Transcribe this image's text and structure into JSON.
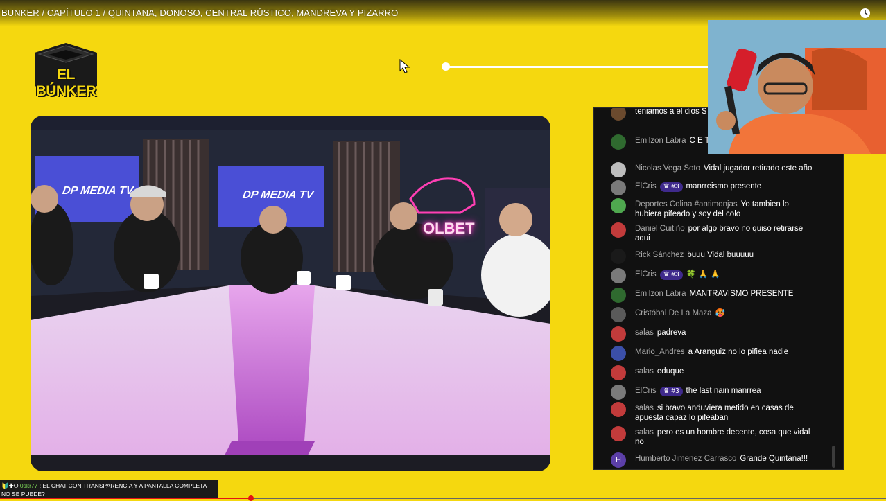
{
  "video": {
    "title": "BUNKER / CAPÍTULO 1 / QUINTANA, DONOSO, CENTRAL RÚSTICO, MANDREVA Y PIZARRO",
    "progress_fraction": 0.283
  },
  "logo": {
    "text": "EL BÚNKER"
  },
  "studio": {
    "tv_label_left": "DP MEDIA TV",
    "tv_label_center": "DP MEDIA TV",
    "neon_sign": "OLBET"
  },
  "chat": {
    "messages": [
      {
        "author": "",
        "badge": "",
        "text": "teniamos a el dios S",
        "avatar_color": "#6b4a2e",
        "avatar_letter": ""
      },
      {
        "author": "Emilzon Labra",
        "badge": "",
        "text": "C E T EL BUNKE",
        "avatar_color": "#2f6a2f",
        "avatar_letter": ""
      },
      {
        "author": "Nicolas Vega Soto",
        "badge": "",
        "text": "Vidal jugador retirado este año",
        "avatar_color": "#bdbdbd",
        "avatar_letter": ""
      },
      {
        "author": "ElCris",
        "badge": "#3",
        "text": "manrreismo presente",
        "avatar_color": "#7a7a7a",
        "avatar_letter": ""
      },
      {
        "author": "Deportes Colina #antimonjas",
        "badge": "",
        "text": "Yo tambien lo hubiera pifeado y soy del colo",
        "avatar_color": "#4fa84f",
        "avatar_letter": ""
      },
      {
        "author": "Daniel Cuitiño",
        "badge": "",
        "text": "por algo bravo no quiso retirarse aqui",
        "avatar_color": "#c23b3b",
        "avatar_letter": ""
      },
      {
        "author": "Rick Sánchez",
        "badge": "",
        "text": "buuu Vidal buuuuu",
        "avatar_color": "#1a1a1a",
        "avatar_letter": ""
      },
      {
        "author": "ElCris",
        "badge": "#3",
        "text": "🍀 🙏 🙏",
        "avatar_color": "#7a7a7a",
        "avatar_letter": ""
      },
      {
        "author": "Emilzon Labra",
        "badge": "",
        "text": "MANTRAVISMO PRESENTE",
        "avatar_color": "#2f6a2f",
        "avatar_letter": ""
      },
      {
        "author": "Cristóbal De La Maza",
        "badge": "",
        "text": "🥵",
        "avatar_color": "#5a5a5a",
        "avatar_letter": ""
      },
      {
        "author": "salas",
        "badge": "",
        "text": "padreva",
        "avatar_color": "#c23b3b",
        "avatar_letter": ""
      },
      {
        "author": "Mario_Andres",
        "badge": "",
        "text": "a Aranguiz no lo pifiea nadie",
        "avatar_color": "#3b4fa8",
        "avatar_letter": ""
      },
      {
        "author": "salas",
        "badge": "",
        "text": "eduque",
        "avatar_color": "#c23b3b",
        "avatar_letter": ""
      },
      {
        "author": "ElCris",
        "badge": "#3",
        "text": "the last nain manrrea",
        "avatar_color": "#7a7a7a",
        "avatar_letter": ""
      },
      {
        "author": "salas",
        "badge": "",
        "text": "si bravo anduviera metido en casas de apuesta capaz lo pifeaban",
        "avatar_color": "#c23b3b",
        "avatar_letter": ""
      },
      {
        "author": "salas",
        "badge": "",
        "text": "pero es un hombre decente, cosa que vidal no",
        "avatar_color": "#c23b3b",
        "avatar_letter": ""
      },
      {
        "author": "Humberto Jimenez Carrasco",
        "badge": "",
        "text": "Grande Quintana!!!",
        "avatar_color": "#5c3fa8",
        "avatar_letter": "H"
      }
    ]
  },
  "ticker": {
    "user": "0skr77",
    "text": "EL CHAT CON TRANSPARENCIA Y A PANTALLA COMPLETA NO SE PUEDE?"
  },
  "icons": {
    "clock": "clock-icon",
    "cursor": "mouse-cursor-icon",
    "crown_badge": "crown-icon"
  }
}
